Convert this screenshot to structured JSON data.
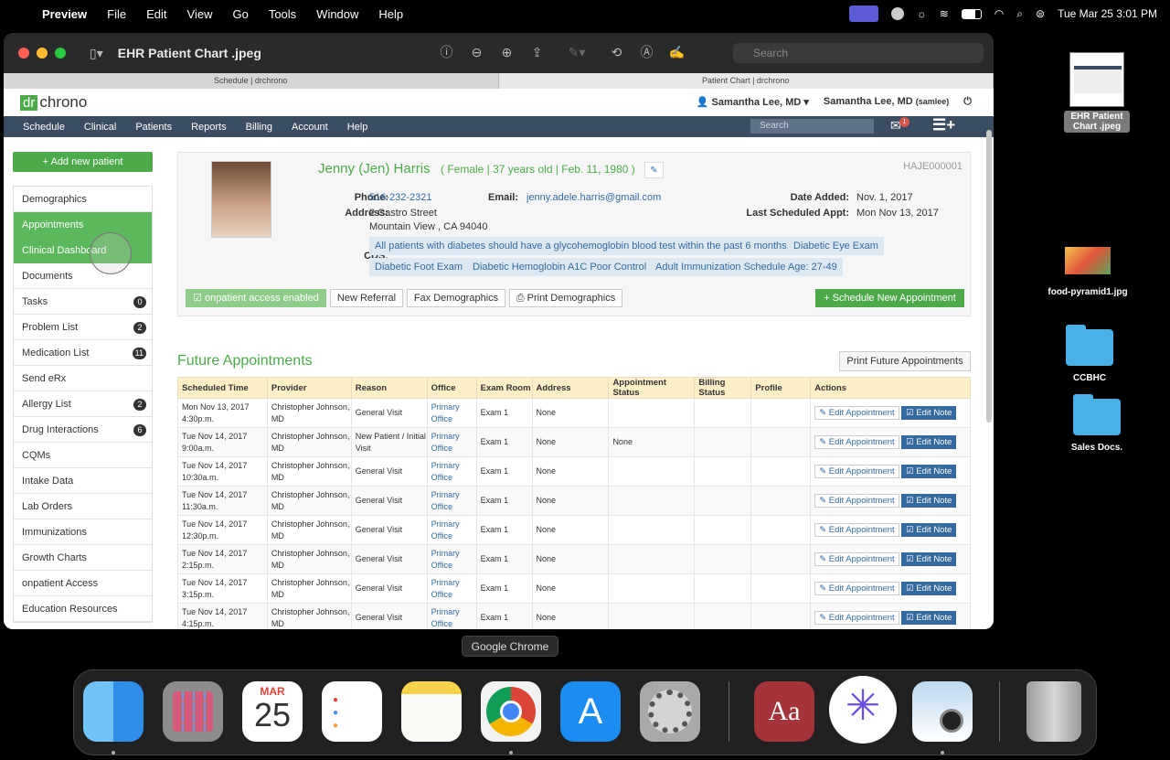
{
  "menubar": {
    "app": "Preview",
    "items": [
      "File",
      "Edit",
      "View",
      "Go",
      "Tools",
      "Window",
      "Help"
    ],
    "clock": "Tue Mar 25  3:01 PM"
  },
  "window": {
    "title": "EHR Patient Chart .jpeg",
    "search_placeholder": "Search",
    "traffic_colors": [
      "#ff5f57",
      "#febc2e",
      "#28c840"
    ]
  },
  "browser_tabs": [
    "Schedule | drchrono",
    "Patient Chart | drchrono"
  ],
  "app": {
    "logo_dr": "dr",
    "logo_rest": "chrono",
    "user_menu": "Samantha Lee, MD",
    "user_name": "Samantha Lee, MD",
    "user_handle": "(samlee)",
    "nav": [
      "Schedule",
      "Clinical",
      "Patients",
      "Reports",
      "Billing",
      "Account",
      "Help"
    ],
    "search_placeholder": "Search",
    "inbox_count": "1"
  },
  "sidebar": {
    "add_patient": "+ Add new patient",
    "items": [
      {
        "label": "Demographics",
        "badge": ""
      },
      {
        "label": "Appointments",
        "badge": "",
        "active": true
      },
      {
        "label": "Clinical Dashboard",
        "badge": "",
        "active": true
      },
      {
        "label": "Documents",
        "badge": ""
      },
      {
        "label": "Tasks",
        "badge": "0"
      },
      {
        "label": "Problem List",
        "badge": "2"
      },
      {
        "label": "Medication List",
        "badge": "11"
      },
      {
        "label": "Send eRx",
        "badge": ""
      },
      {
        "label": "Allergy List",
        "badge": "2"
      },
      {
        "label": "Drug Interactions",
        "badge": "6"
      },
      {
        "label": "CQMs",
        "badge": ""
      },
      {
        "label": "Intake Data",
        "badge": ""
      },
      {
        "label": "Lab Orders",
        "badge": ""
      },
      {
        "label": "Immunizations",
        "badge": ""
      },
      {
        "label": "Growth Charts",
        "badge": ""
      },
      {
        "label": "onpatient Access",
        "badge": ""
      },
      {
        "label": "Education Resources",
        "badge": ""
      }
    ]
  },
  "patient": {
    "name": "Jenny (Jen) Harris",
    "meta": "( Female | 37 years old | Feb. 11, 1980 )",
    "id": "HAJE000001",
    "phone_label": "Phone:",
    "phone": "516-232-2321",
    "email_label": "Email:",
    "email": "jenny.adele.harris@gmail.com",
    "address_label": "Address:",
    "address_1": "2 Castro Street",
    "address_2": "Mountain View , CA 94040",
    "date_added_label": "Date Added:",
    "date_added": "Nov. 1, 2017",
    "last_appt_label": "Last Scheduled Appt:",
    "last_appt": "Mon Nov 13, 2017",
    "cds_label": "CDS:",
    "cds": [
      "All patients with diabetes should have a glycohemoglobin blood test within the past 6 months.",
      "Diabetic Eye Exam",
      "Diabetic Foot Exam",
      "Diabetic Hemoglobin A1C Poor Control",
      "Adult Immunization Schedule Age: 27-49"
    ],
    "buttons": {
      "onpatient": "☑ onpatient access enabled",
      "referral": "New Referral",
      "fax": "Fax Demographics",
      "print": "⎙ Print Demographics",
      "schedule": "+ Schedule New Appointment"
    }
  },
  "future": {
    "title": "Future Appointments",
    "print": "Print Future Appointments",
    "columns": [
      "Scheduled Time",
      "Provider",
      "Reason",
      "Office",
      "Exam Room",
      "Address",
      "Appointment Status",
      "Billing Status",
      "Profile",
      "Actions"
    ],
    "edit_label": "✎ Edit Appointment",
    "note_label": "☑ Edit Note",
    "rows": [
      {
        "time": "Mon Nov 13, 2017 4:30p.m.",
        "provider": "Christopher Johnson, MD",
        "reason": "General Visit",
        "office": "Primary Office",
        "room": "Exam 1",
        "address": "None",
        "status": "",
        "billing": "",
        "profile": ""
      },
      {
        "time": "Tue Nov 14, 2017 9:00a.m.",
        "provider": "Christopher Johnson, MD",
        "reason": "New Patient / Initial Visit",
        "office": "Primary Office",
        "room": "Exam 1",
        "address": "None",
        "status": "None",
        "billing": "",
        "profile": ""
      },
      {
        "time": "Tue Nov 14, 2017 10:30a.m.",
        "provider": "Christopher Johnson, MD",
        "reason": "General Visit",
        "office": "Primary Office",
        "room": "Exam 1",
        "address": "None",
        "status": "",
        "billing": "",
        "profile": ""
      },
      {
        "time": "Tue Nov 14, 2017 11:30a.m.",
        "provider": "Christopher Johnson, MD",
        "reason": "General Visit",
        "office": "Primary Office",
        "room": "Exam 1",
        "address": "None",
        "status": "",
        "billing": "",
        "profile": ""
      },
      {
        "time": "Tue Nov 14, 2017 12:30p.m.",
        "provider": "Christopher Johnson, MD",
        "reason": "General Visit",
        "office": "Primary Office",
        "room": "Exam 1",
        "address": "None",
        "status": "",
        "billing": "",
        "profile": ""
      },
      {
        "time": "Tue Nov 14, 2017 2:15p.m.",
        "provider": "Christopher Johnson, MD",
        "reason": "General Visit",
        "office": "Primary Office",
        "room": "Exam 1",
        "address": "None",
        "status": "",
        "billing": "",
        "profile": ""
      },
      {
        "time": "Tue Nov 14, 2017 3:15p.m.",
        "provider": "Christopher Johnson, MD",
        "reason": "General Visit",
        "office": "Primary Office",
        "room": "Exam 1",
        "address": "None",
        "status": "",
        "billing": "",
        "profile": ""
      },
      {
        "time": "Tue Nov 14, 2017 4:15p.m.",
        "provider": "Christopher Johnson, MD",
        "reason": "General Visit",
        "office": "Primary Office",
        "room": "Exam 1",
        "address": "None",
        "status": "",
        "billing": "",
        "profile": ""
      }
    ]
  },
  "desktop": {
    "items": [
      {
        "label": "EHR Patient Chart .jpeg",
        "kind": "image"
      },
      {
        "label": "food-pyramid1.jpg",
        "kind": "image"
      },
      {
        "label": "CCBHC",
        "kind": "folder"
      },
      {
        "label": "Sales Docs.",
        "kind": "folder"
      }
    ]
  },
  "dock": {
    "tooltip": "Google Chrome",
    "calendar_month": "MAR",
    "calendar_day": "25",
    "dictionary_glyph": "Aa",
    "apps": [
      "finder-icon",
      "launchpad-icon",
      "calendar-icon",
      "reminders-icon",
      "notes-icon",
      "chrome-icon",
      "app-store-icon",
      "system-settings-icon",
      "dictionary-icon",
      "perplexity-icon",
      "preview-icon",
      "trash-icon"
    ]
  }
}
